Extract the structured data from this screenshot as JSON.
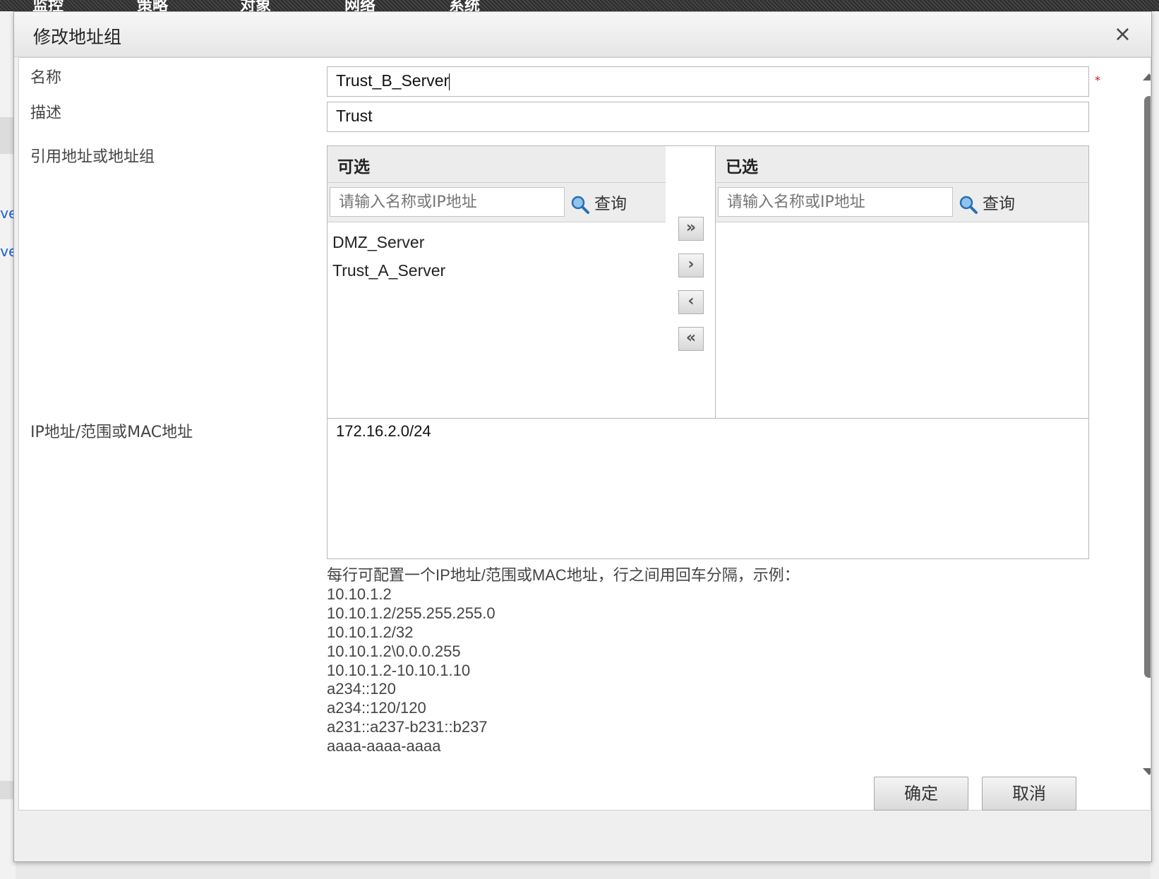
{
  "top_nav": [
    "监控",
    "策略",
    "对象",
    "网络",
    "系统"
  ],
  "dialog": {
    "title": "修改地址组",
    "close_icon": "×"
  },
  "form": {
    "name_label": "名称",
    "name_value": "Trust_B_Server",
    "required_mark": "*",
    "desc_label": "描述",
    "desc_value": "Trust",
    "ref_label": "引用地址或地址组",
    "ip_label": "IP地址/范围或MAC地址",
    "ip_value": "172.16.2.0/24"
  },
  "available": {
    "title": "可选",
    "search_placeholder": "请输入名称或IP地址",
    "search_label": "查询",
    "items": [
      "DMZ_Server",
      "Trust_A_Server"
    ]
  },
  "selected": {
    "title": "已选",
    "search_placeholder": "请输入名称或IP地址",
    "search_label": "查询",
    "items": []
  },
  "move_buttons": {
    "add_all": "»",
    "add": "›",
    "remove": "‹",
    "remove_all": "«"
  },
  "hint": {
    "intro": "每行可配置一个IP地址/范围或MAC地址，行之间用回车分隔，示例：",
    "examples": [
      "10.10.1.2",
      "10.10.1.2/255.255.255.0",
      "10.10.1.2/32",
      "10.10.1.2\\0.0.0.255",
      "10.10.1.2-10.10.1.10",
      "a234::120",
      "a234::120/120",
      "a231::a237-b231::b237",
      "aaaa-aaaa-aaaa"
    ]
  },
  "footer": {
    "ok_label": "确定",
    "cancel_label": "取消"
  },
  "background": {
    "link_fragment_1": "rve",
    "link_fragment_2": "rve"
  }
}
